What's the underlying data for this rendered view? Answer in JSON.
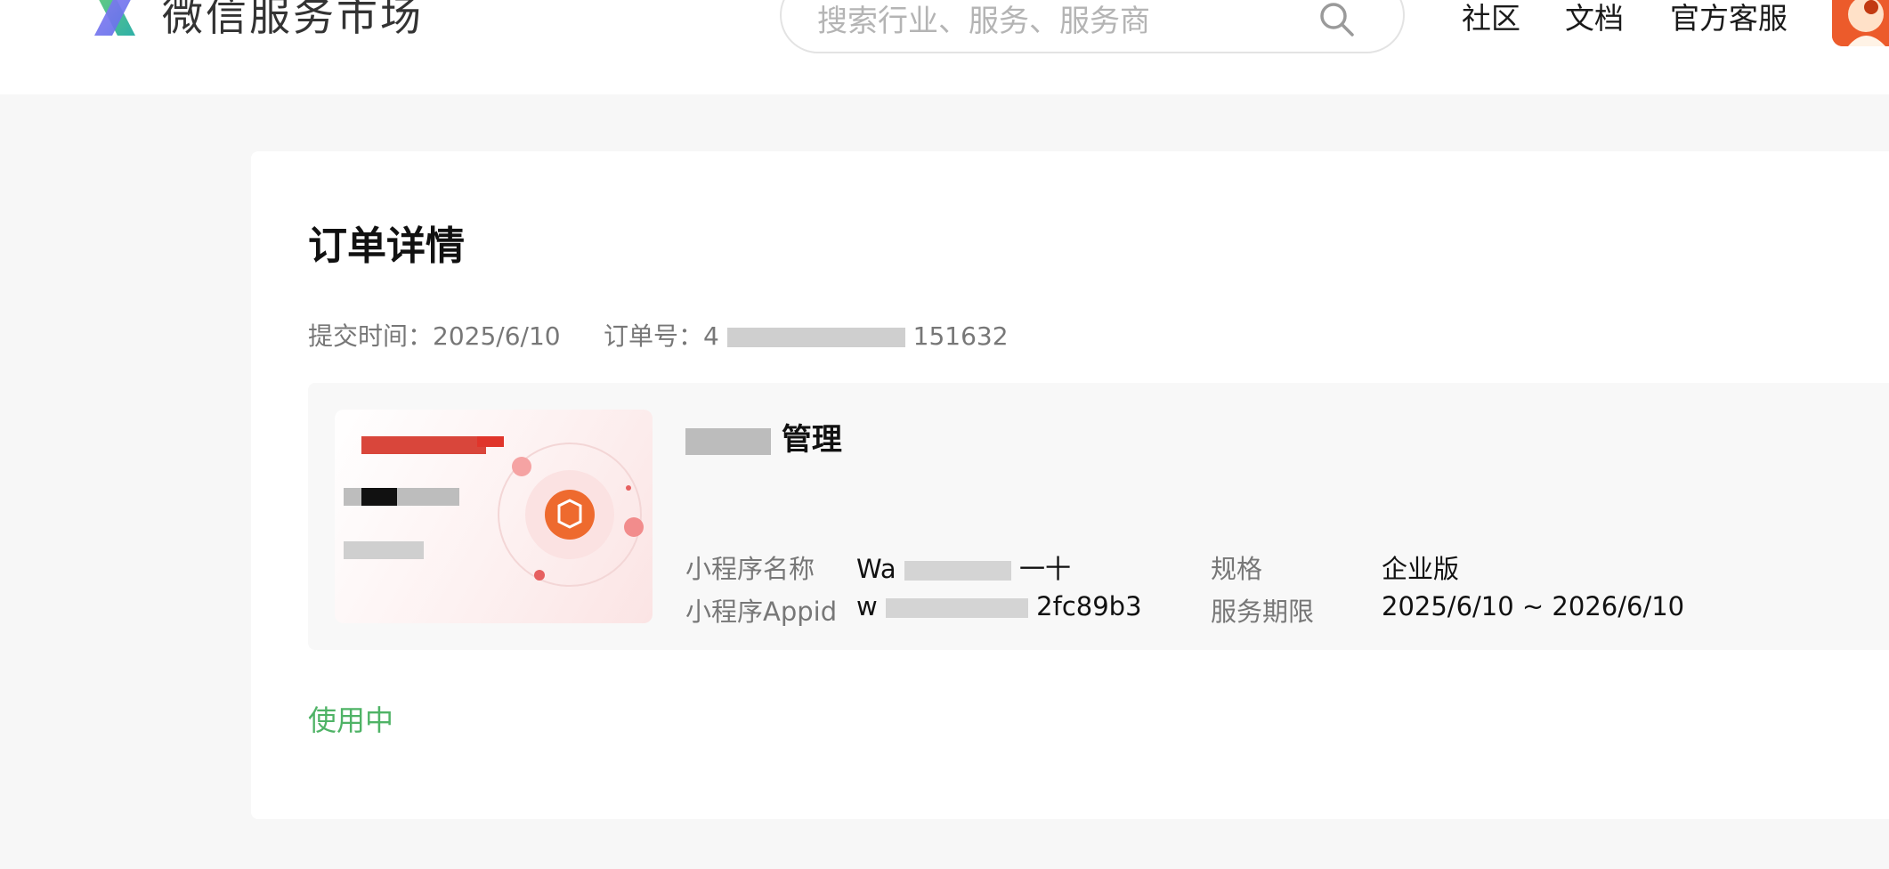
{
  "header": {
    "brand": "微信服务市场",
    "search_placeholder": "搜索行业、服务、服务商",
    "nav": [
      "社区",
      "文档",
      "官方客服"
    ]
  },
  "order": {
    "title": "订单详情",
    "submit_time_label": "提交时间：",
    "submit_time": "2025/6/10",
    "order_no_label": "订单号：",
    "order_no_prefix": "4",
    "order_no_suffix": "151632",
    "product_name_visible": "管理",
    "fields": {
      "mini_program_name_label": "小程序名称",
      "mini_program_name_prefix": "Wa",
      "mini_program_name_suffix": "一十",
      "appid_label": "小程序Appid",
      "appid_prefix": "w",
      "appid_suffix": "2fc89b3",
      "spec_label": "规格",
      "spec_value": "企业版",
      "period_label": "服务期限",
      "period_value": "2025/6/10 ~ 2026/6/10"
    },
    "status": "使用中"
  },
  "colors": {
    "accent_green": "#4fb366",
    "brand_orange": "#ec5b2b",
    "page_bg": "#f7f7f7"
  },
  "icons": {
    "logo": "wechat-service-market-logo",
    "search": "search-icon",
    "avatar": "user-avatar",
    "thumb_center": "box-icon"
  }
}
